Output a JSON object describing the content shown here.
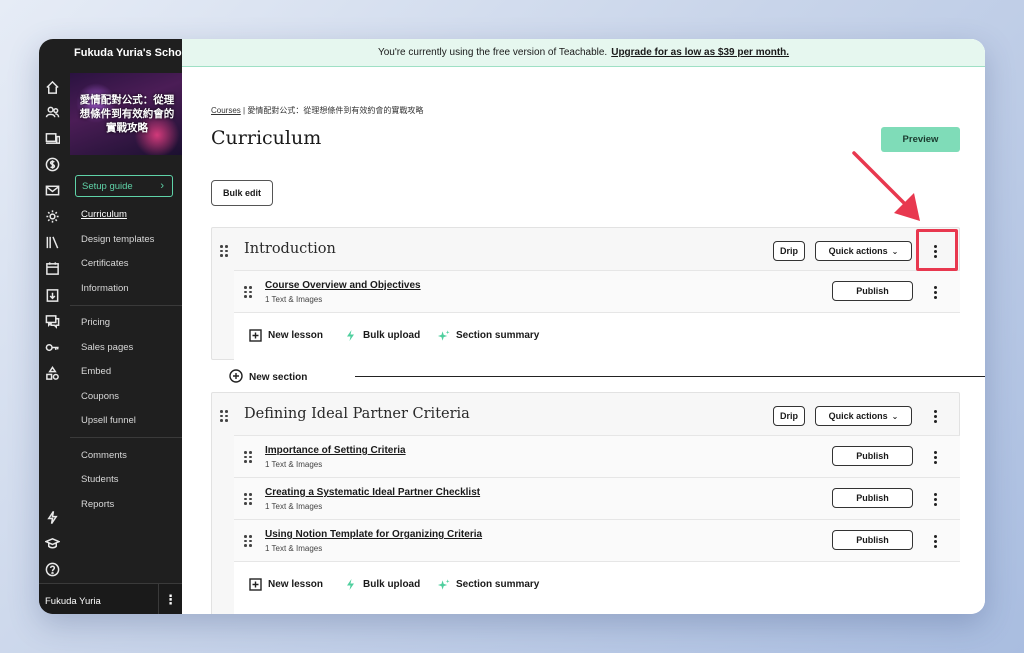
{
  "school_name": "Fukuda Yuria's School",
  "course_thumbnail_title": "愛情配對公式：從理想條件到有效約會的實戰攻略",
  "banner": {
    "text": "You're currently using the free version of Teachable.",
    "upgrade_link": "Upgrade for as low as $39 per month."
  },
  "nav": {
    "setup_guide": "Setup guide",
    "items_group1": [
      "Curriculum",
      "Design templates",
      "Certificates",
      "Information"
    ],
    "items_group2": [
      "Pricing",
      "Sales pages",
      "Embed",
      "Coupons",
      "Upsell funnel"
    ],
    "items_group3": [
      "Comments",
      "Students",
      "Reports"
    ],
    "active": "Curriculum",
    "user_name": "Fukuda Yuria"
  },
  "rail_icons": [
    "home-icon",
    "users-icon",
    "devices-icon",
    "dollar-icon",
    "mail-icon",
    "settings-icon",
    "library-icon",
    "calendar-icon",
    "download-icon",
    "chat-icon",
    "key-icon",
    "shapes-icon",
    "lightning-icon",
    "graduation-cap-icon",
    "help-icon"
  ],
  "breadcrumb": {
    "root": "Courses",
    "separator": "|",
    "course": "愛情配對公式：從理想條件到有效約會的實戰攻略"
  },
  "page_title": "Curriculum",
  "preview_label": "Preview",
  "bulk_edit_label": "Bulk edit",
  "drip_label": "Drip",
  "quick_actions_label": "Quick actions",
  "publish_label": "Publish",
  "new_section_label": "New section",
  "actions": {
    "new_lesson": "New lesson",
    "bulk_upload": "Bulk upload",
    "section_summary": "Section summary"
  },
  "sections": [
    {
      "title": "Introduction",
      "lessons": [
        {
          "title": "Course Overview and Objectives",
          "subtitle": "1 Text & Images"
        }
      ]
    },
    {
      "title": "Defining Ideal Partner Criteria",
      "lessons": [
        {
          "title": "Importance of Setting Criteria",
          "subtitle": "1 Text & Images"
        },
        {
          "title": "Creating a Systematic Ideal Partner Checklist",
          "subtitle": "1 Text & Images"
        },
        {
          "title": "Using Notion Template for Organizing Criteria",
          "subtitle": "1 Text & Images"
        }
      ]
    }
  ],
  "colors": {
    "accent_green": "#7fdcb8",
    "highlight_red": "#e8384f",
    "sidebar_bg": "#1f1f1f"
  }
}
